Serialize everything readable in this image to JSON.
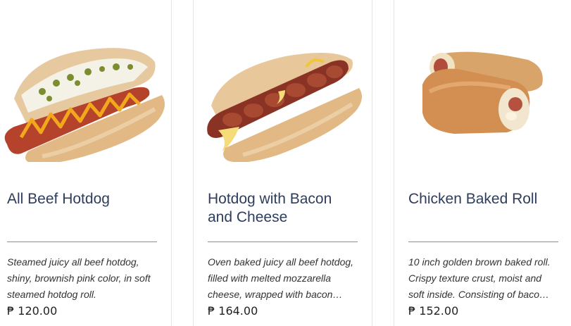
{
  "products": [
    {
      "title": "All Beef Hotdog",
      "description_lines": [
        "Steamed juicy  all beef hotdog,",
        "shiny, brownish pink color, in soft",
        "steamed hotdog roll."
      ],
      "price": "₱ 120.00",
      "image_icon": "all-beef-hotdog-image"
    },
    {
      "title_lines": [
        "Hotdog with Bacon",
        "and Cheese"
      ],
      "description_lines": [
        "Oven baked juicy all beef hotdog,",
        "filled with melted mozzarella",
        "cheese, wrapped with bacon…"
      ],
      "price": "₱ 164.00",
      "image_icon": "bacon-cheese-hotdog-image"
    },
    {
      "title": "Chicken Baked Roll",
      "description_lines": [
        "10 inch golden brown baked roll.",
        "Crispy texture crust, moist and",
        "soft inside. Consisting of baco…"
      ],
      "price": "₱ 152.00",
      "image_icon": "chicken-baked-roll-image"
    }
  ],
  "colors": {
    "title": "#2e3d5c",
    "divider": "#e4e4e4",
    "rule": "#8e8e8e"
  }
}
